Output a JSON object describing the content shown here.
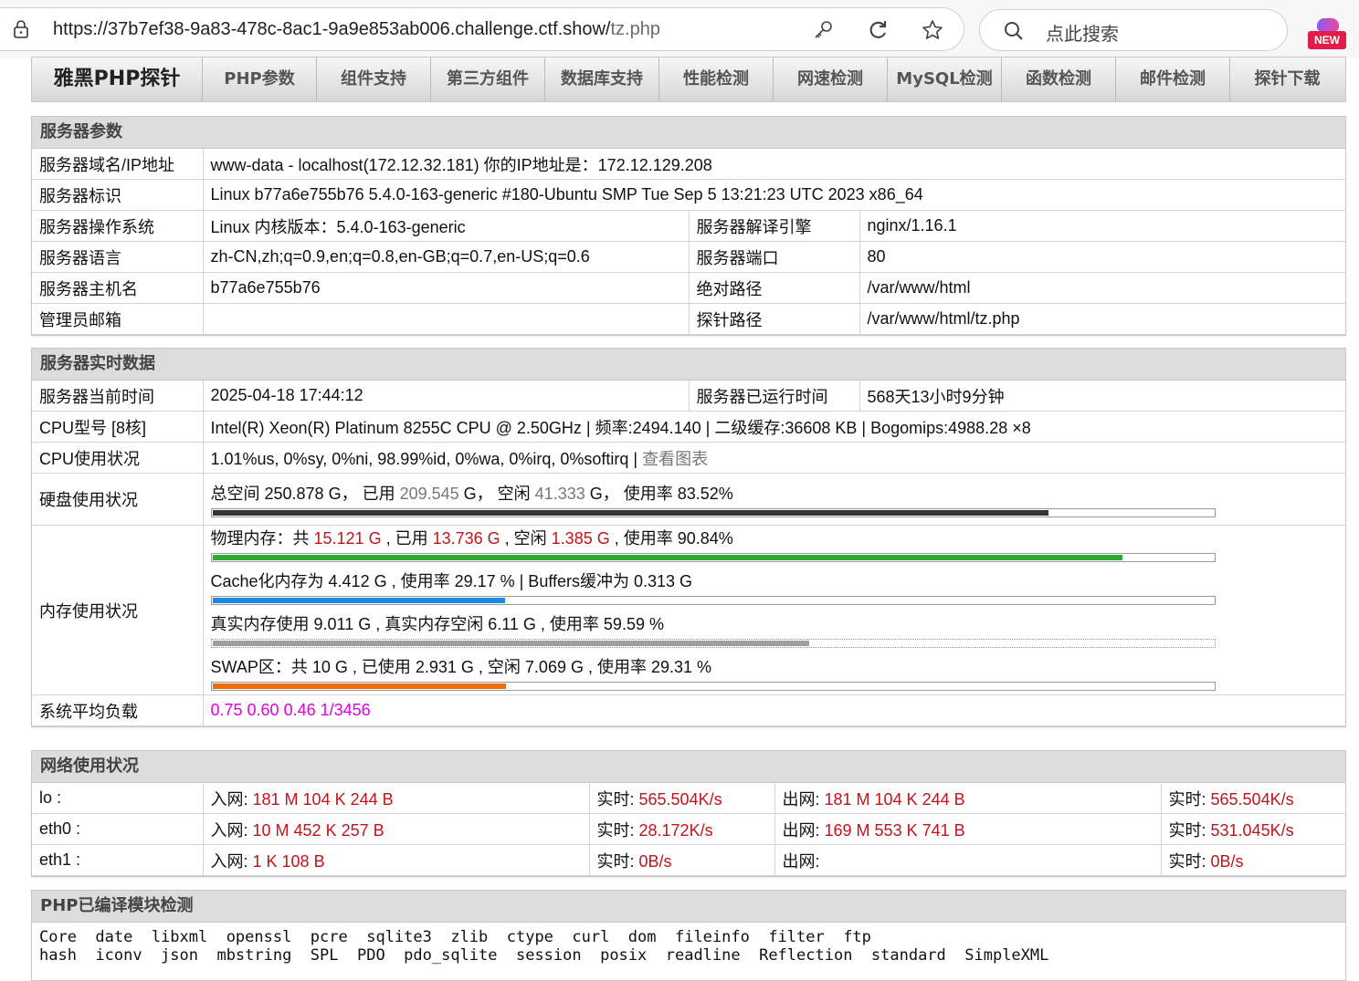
{
  "browser": {
    "url_prefix": "https://37b7ef38-9a83-478c-8ac1-9a9e853ab006.challenge.ctf.show/",
    "url_path": "tz.php",
    "search_placeholder": "点此搜索",
    "new_badge": "NEW"
  },
  "nav": {
    "brand": "雅黑PHP探针",
    "items": [
      "PHP参数",
      "组件支持",
      "第三方组件",
      "数据库支持",
      "性能检测",
      "网速检测",
      "MySQL检测",
      "函数检测",
      "邮件检测",
      "探针下载"
    ]
  },
  "server_params": {
    "title": "服务器参数",
    "domain_label": "服务器域名/IP地址",
    "domain_value": "www-data - localhost(172.12.32.181)  你的IP地址是：172.12.129.208",
    "ident_label": "服务器标识",
    "ident_value": "Linux b77a6e755b76 5.4.0-163-generic #180-Ubuntu SMP Tue Sep 5 13:21:23 UTC 2023 x86_64",
    "os_label": "服务器操作系统",
    "os_value": "Linux  内核版本：5.4.0-163-generic",
    "engine_label": "服务器解译引擎",
    "engine_value": "nginx/1.16.1",
    "lang_label": "服务器语言",
    "lang_value": "zh-CN,zh;q=0.9,en;q=0.8,en-GB;q=0.7,en-US;q=0.6",
    "port_label": "服务器端口",
    "port_value": "80",
    "host_label": "服务器主机名",
    "host_value": "b77a6e755b76",
    "abspath_label": "绝对路径",
    "abspath_value": "/var/www/html",
    "admin_label": "管理员邮箱",
    "admin_value": "",
    "probe_label": "探针路径",
    "probe_value": "/var/www/html/tz.php"
  },
  "realtime": {
    "title": "服务器实时数据",
    "time_label": "服务器当前时间",
    "time_value": "2025-04-18 17:44:12",
    "uptime_label": "服务器已运行时间",
    "uptime_value": "568天13小时9分钟",
    "cpu_label": "CPU型号 [8核]",
    "cpu_value": "Intel(R) Xeon(R) Platinum 8255C CPU @ 2.50GHz | 频率:2494.140 | 二级缓存:36608 KB | Bogomips:4988.28 ×8",
    "cpuuse_label": "CPU使用状况",
    "cpuuse_value": "1.01%us, 0%sy, 0%ni, 98.99%id, 0%wa, 0%irq, 0%softirq | ",
    "cpuuse_link": "查看图表",
    "disk_label": "硬盘使用状况",
    "disk": {
      "t1": "总空间 250.878 G，  已用 ",
      "used": "209.545",
      "t2": " G，  空闲 ",
      "free": "41.333",
      "t3": " G，  使用率 83.52%",
      "percent": 83.52,
      "color": "#333333"
    },
    "mem_label": "内存使用状况",
    "mem_phys": {
      "t1": "物理内存：共 ",
      "total": "15.121 G",
      "t2": " , 已用 ",
      "used": "13.736 G",
      "t3": " , 空闲 ",
      "free": "1.385 G",
      "t4": " , 使用率 90.84%",
      "percent": 90.84,
      "color": "#2eaa2e"
    },
    "mem_cache": {
      "text": "Cache化内存为 4.412 G , 使用率 29.17 % | Buffers缓冲为 0.313 G",
      "percent": 29.17,
      "color": "#1e88e5"
    },
    "mem_real": {
      "text": "真实内存使用 9.011 G , 真实内存空闲 6.11 G , 使用率 59.59 %",
      "percent": 59.59,
      "color": "#9e9e9e"
    },
    "mem_swap": {
      "text": "SWAP区：共 10 G , 已使用 2.931 G , 空闲 7.069 G , 使用率 29.31 %",
      "percent": 29.31,
      "color": "#f26a10"
    },
    "load_label": "系统平均负载",
    "load_value": "0.75 0.60 0.46 1/3456"
  },
  "network": {
    "title": "网络使用状况",
    "in_label": "入网: ",
    "out_label": "出网: ",
    "rt_label": "实时: ",
    "rows": [
      {
        "name": "lo :",
        "in": "181 M 104 K 244 B",
        "in_rt": "565.504K/s",
        "out": "181 M 104 K 244 B",
        "out_rt": "565.504K/s"
      },
      {
        "name": "eth0 :",
        "in": "10 M 452 K 257 B",
        "in_rt": "28.172K/s",
        "out": "169 M 553 K 741 B",
        "out_rt": "531.045K/s"
      },
      {
        "name": "eth1 :",
        "in": "1 K 108 B",
        "in_rt": "0B/s",
        "out": "",
        "out_rt": "0B/s"
      }
    ]
  },
  "modules": {
    "title": "PHP已编译模块检测",
    "line1": "Core  date  libxml  openssl  pcre  sqlite3  zlib  ctype  curl  dom  fileinfo  filter  ftp",
    "line2": "hash  iconv  json  mbstring  SPL  PDO  pdo_sqlite  session  posix  readline  Reflection  standard  SimpleXML"
  },
  "colors": {
    "accent_red": "#c0141b",
    "load_magenta": "#e000e0"
  }
}
